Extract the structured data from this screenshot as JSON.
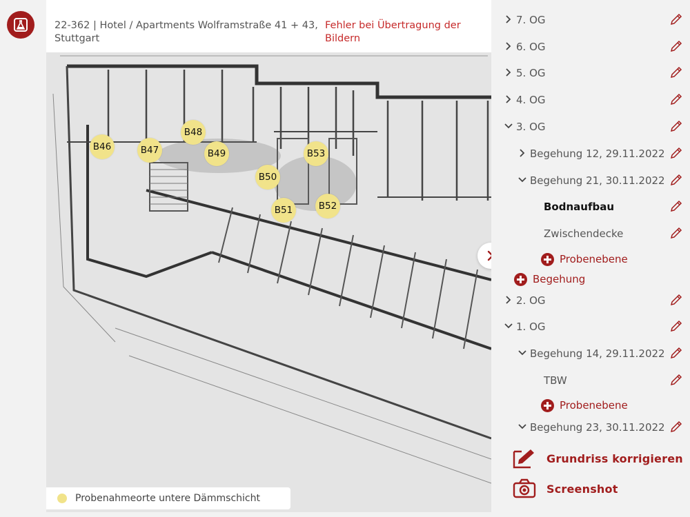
{
  "header": {
    "project_title": "22-362 | Hotel / Apartments Wolframstraße 41 + 43, Stuttgart",
    "error_message": "Fehler bei Übertragung der Bildern"
  },
  "plan": {
    "markers": [
      {
        "label": "B46"
      },
      {
        "label": "B47"
      },
      {
        "label": "B48"
      },
      {
        "label": "B49"
      },
      {
        "label": "B50"
      },
      {
        "label": "B51"
      },
      {
        "label": "B52"
      },
      {
        "label": "B53"
      }
    ],
    "legend": "Probenahmeorte untere Dämmschicht",
    "marker_color": "#f1e38a"
  },
  "tree": {
    "items": [
      {
        "label": "7. OG",
        "state": "collapsed"
      },
      {
        "label": "6. OG",
        "state": "collapsed"
      },
      {
        "label": "5. OG",
        "state": "collapsed"
      },
      {
        "label": "4. OG",
        "state": "collapsed"
      },
      {
        "label": "3. OG",
        "state": "expanded"
      },
      {
        "label": "Begehung 12, 29.11.2022",
        "state": "collapsed"
      },
      {
        "label": "Begehung 21, 30.11.2022",
        "state": "expanded"
      },
      {
        "label": "Bodnaufbau",
        "state": "selected"
      },
      {
        "label": "Zwischendecke",
        "state": "leaf"
      },
      {
        "label": "Probenebene",
        "state": "add"
      },
      {
        "label": "Begehung",
        "state": "add"
      },
      {
        "label": "2. OG",
        "state": "collapsed"
      },
      {
        "label": "1. OG",
        "state": "expanded"
      },
      {
        "label": "Begehung 14, 29.11.2022",
        "state": "expanded"
      },
      {
        "label": "TBW",
        "state": "leaf"
      },
      {
        "label": "Probenebene",
        "state": "add"
      },
      {
        "label": "Begehung 23, 30.11.2022",
        "state": "expanded"
      }
    ]
  },
  "actions": {
    "correct_plan": "Grundriss korrigieren",
    "screenshot": "Screenshot"
  },
  "colors": {
    "accent": "#a11d1d",
    "error": "#c62a2a"
  },
  "icons": {
    "logo": "flask-icon",
    "edit": "pencil-icon",
    "add": "plus-circle-icon",
    "toggle": "chevron-right-icon",
    "correct": "edit-square-icon",
    "screenshot": "camera-icon"
  }
}
